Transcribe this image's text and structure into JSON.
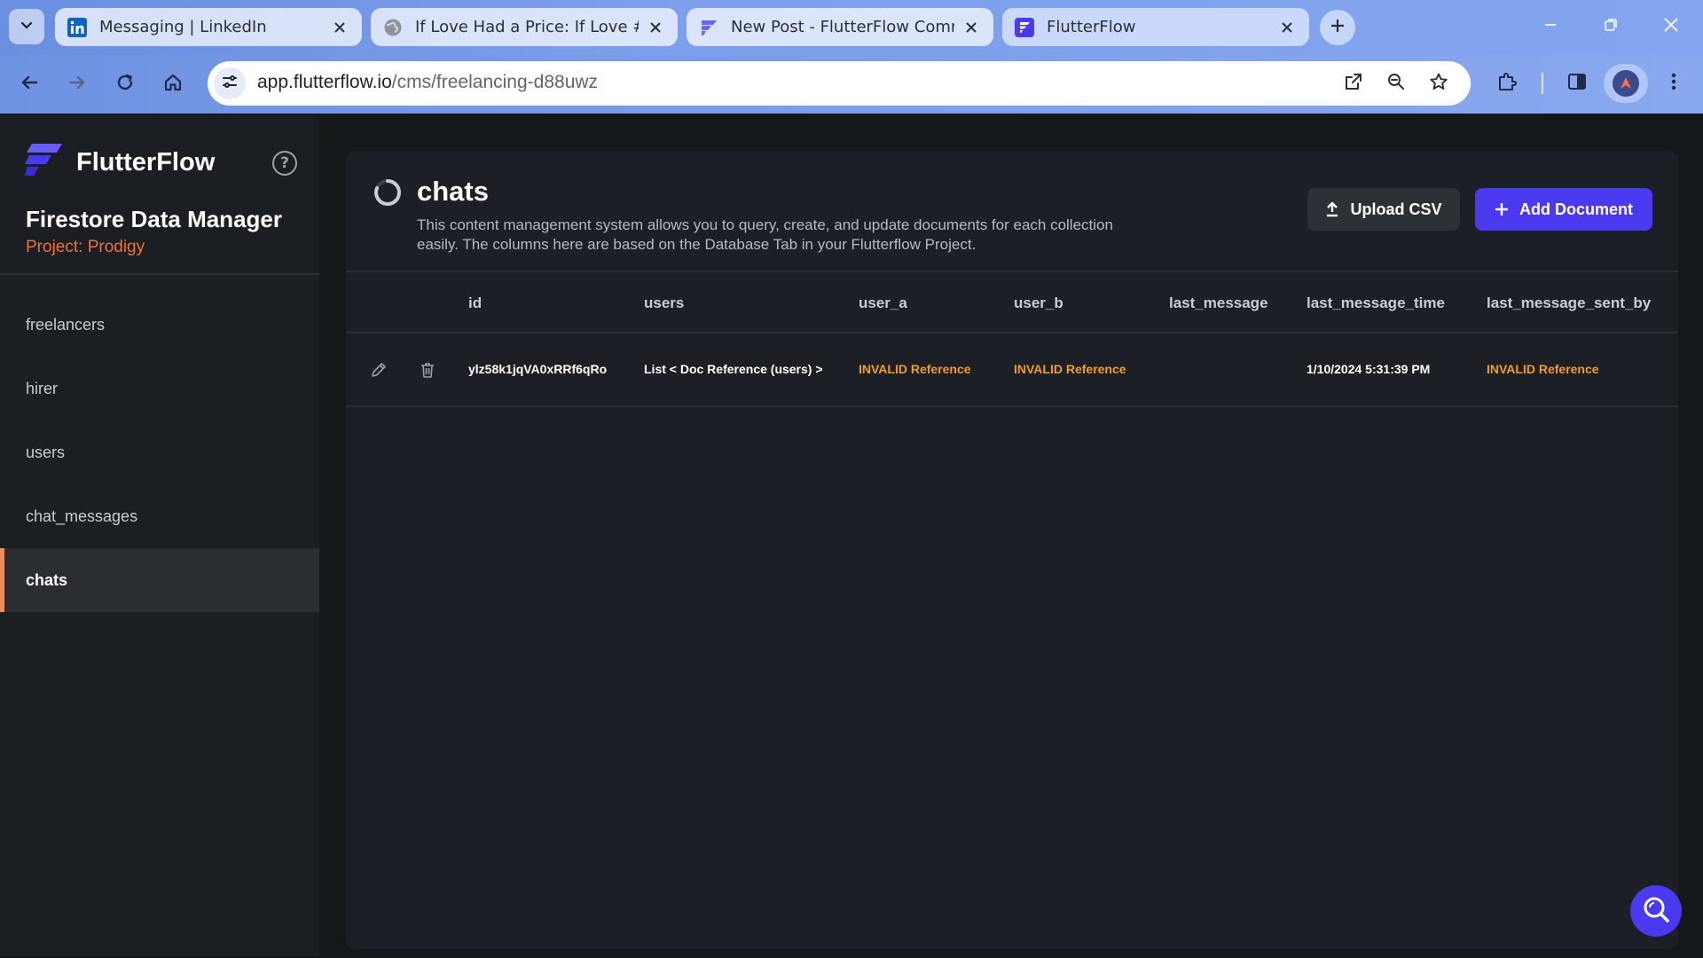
{
  "browser": {
    "tabs": [
      {
        "title": "Messaging | LinkedIn",
        "icon": "linkedin-icon"
      },
      {
        "title": "If Love Had a Price: If Love #3",
        "icon": "globe-icon"
      },
      {
        "title": "New Post - FlutterFlow Commu",
        "icon": "flutterflow-icon"
      },
      {
        "title": "FlutterFlow",
        "icon": "flutterflow-icon",
        "active": true
      }
    ],
    "url_host": "app.flutterflow.io",
    "url_path": "/cms/freelancing-d88uwz"
  },
  "sidebar": {
    "brand": "FlutterFlow",
    "title": "Firestore Data Manager",
    "project": "Project: Prodigy",
    "collections": [
      {
        "label": "freelancers"
      },
      {
        "label": "hirer"
      },
      {
        "label": "users"
      },
      {
        "label": "chat_messages"
      },
      {
        "label": "chats",
        "active": true
      }
    ]
  },
  "main": {
    "title": "chats",
    "description": "This content management system allows you to query, create, and update documents for each collection easily. The columns here are based on the Database Tab in your Flutterflow Project.",
    "upload_label": "Upload CSV",
    "add_label": "Add Document",
    "columns": [
      "id",
      "users",
      "user_a",
      "user_b",
      "last_message",
      "last_message_time",
      "last_message_sent_by"
    ],
    "rows": [
      {
        "id": "ylz58k1jqVA0xRRf6qRo",
        "users": "List < Doc Reference (users) >",
        "user_a": "INVALID Reference",
        "user_b": "INVALID Reference",
        "last_message": "",
        "last_message_time": "1/10/2024 5:31:39 PM",
        "last_message_sent_by": "INVALID Reference"
      }
    ]
  },
  "colors": {
    "accent": "#4b39ef",
    "project": "#f0713a",
    "invalid": "#f39b2a",
    "active_marker": "#ee8b60"
  }
}
